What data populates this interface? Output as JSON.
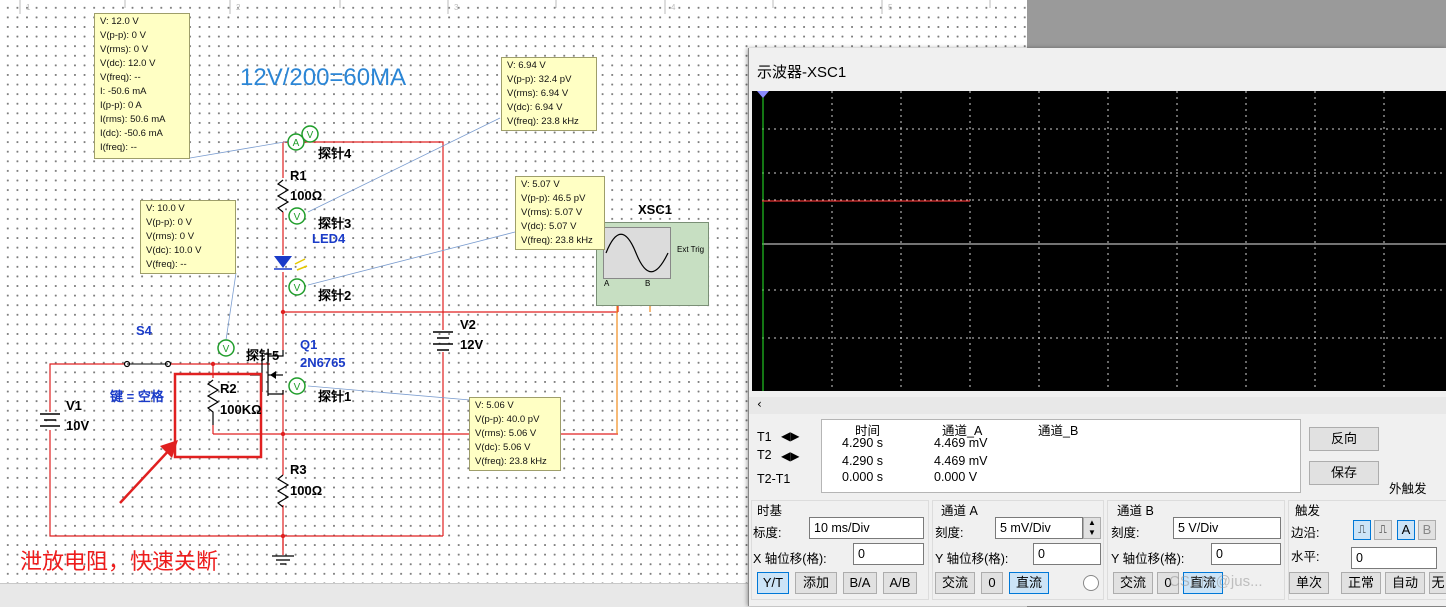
{
  "circuit": {
    "ruler_numbers": [
      "1",
      "2",
      "3",
      "4",
      "5",
      "6",
      "7",
      "8"
    ],
    "heading": "12V/200=60MA",
    "annotation": "泄放电阻，快速关断",
    "switch": {
      "name": "S4",
      "key": "键 = 空格"
    },
    "components": {
      "r1": {
        "ref": "R1",
        "value": "100Ω"
      },
      "r2": {
        "ref": "R2",
        "value": "100KΩ"
      },
      "r3": {
        "ref": "R3",
        "value": "100Ω"
      },
      "led": {
        "ref": "LED4"
      },
      "q1": {
        "ref": "Q1",
        "part": "2N6765"
      },
      "v1": {
        "ref": "V1",
        "value": "10V"
      },
      "v2": {
        "ref": "V2",
        "value": "12V"
      },
      "scope": {
        "ref": "XSC1",
        "ext_trig": "Ext Trig",
        "ch_a": "A",
        "ch_b": "B"
      }
    },
    "probes": {
      "p4": {
        "label": "探针4",
        "lines": [
          "V: 12.0 V",
          "V(p-p): 0 V",
          "V(rms): 0 V",
          "V(dc): 12.0 V",
          "V(freq): --",
          "I: -50.6 mA",
          "I(p-p): 0 A",
          "I(rms): 50.6 mA",
          "I(dc): -50.6 mA",
          "I(freq): --"
        ]
      },
      "p3": {
        "label": "探针3",
        "lines": [
          "V: 6.94 V",
          "V(p-p): 32.4 pV",
          "V(rms): 6.94 V",
          "V(dc): 6.94 V",
          "V(freq): 23.8 kHz"
        ]
      },
      "p2": {
        "label": "探针2",
        "lines": [
          "V: 5.07 V",
          "V(p-p): 46.5 pV",
          "V(rms): 5.07 V",
          "V(dc): 5.07 V",
          "V(freq): 23.8 kHz"
        ]
      },
      "p5": {
        "label": "探针5",
        "lines": [
          "V: 10.0 V",
          "V(p-p): 0 V",
          "V(rms): 0 V",
          "V(dc): 10.0 V",
          "V(freq): --"
        ]
      },
      "p1": {
        "label": "探针1",
        "lines": [
          "V: 5.06 V",
          "V(p-p): 40.0 pV",
          "V(rms): 5.06 V",
          "V(dc): 5.06 V",
          "V(freq): 23.8 kHz"
        ]
      }
    }
  },
  "scope": {
    "title": "示波器-XSC1",
    "readout": {
      "headers": [
        "时间",
        "通道_A",
        "通道_B"
      ],
      "rows": [
        {
          "label": "T1",
          "time": "4.290 s",
          "a": "4.469 mV",
          "b": ""
        },
        {
          "label": "T2",
          "time": "4.290 s",
          "a": "4.469 mV",
          "b": ""
        },
        {
          "label": "T2-T1",
          "time": "0.000 s",
          "a": "0.000 V",
          "b": ""
        }
      ]
    },
    "buttons": {
      "reverse": "反向",
      "save": "保存",
      "ext_trigger": "外触发"
    },
    "timebase": {
      "title": "时基",
      "scale_label": "标度:",
      "scale_value": "10 ms/Div",
      "xpos_label": "X 轴位移(格):",
      "xpos_value": "0",
      "yt": "Y/T",
      "add": "添加",
      "ba": "B/A",
      "ab": "A/B"
    },
    "channel_a": {
      "title": "通道 A",
      "scale_label": "刻度:",
      "scale_value": "5 mV/Div",
      "ypos_label": "Y 轴位移(格):",
      "ypos_value": "0",
      "ac": "交流",
      "zero": "0",
      "dc": "直流"
    },
    "channel_b": {
      "title": "通道 B",
      "scale_label": "刻度:",
      "scale_value": "5  V/Div",
      "ypos_label": "Y 轴位移(格):",
      "ypos_value": "0",
      "ac": "交流",
      "zero": "0",
      "dc": "直流"
    },
    "trigger": {
      "title": "触发",
      "edge_label": "边沿:",
      "level_label": "水平:",
      "level_value": "0",
      "a": "A",
      "b": "B",
      "single": "单次",
      "normal": "正常",
      "auto": "自动",
      "none": "无"
    },
    "watermark": "CSDN @jus..."
  },
  "colors": {
    "wire_red": "#e02020",
    "wire_orange": "#f08c1e",
    "probe_green": "#1f9d2a",
    "trace": "#e03030",
    "screen_grid": "#cfcfcf"
  }
}
